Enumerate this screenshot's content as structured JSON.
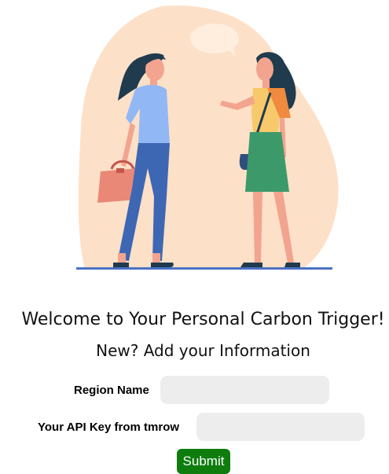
{
  "welcome_title": "Welcome to Your Personal Carbon Trigger!",
  "subtitle": "New? Add your Information",
  "form": {
    "region": {
      "label": "Region Name",
      "value": "",
      "placeholder": ""
    },
    "api_key": {
      "label": "Your API Key from tmrow",
      "value": "",
      "placeholder": ""
    },
    "submit_label": "Submit"
  },
  "colors": {
    "background": "#ffffff",
    "blob": "#fde0c8",
    "submit": "#0e7d0e",
    "input_bg": "#ededed",
    "ground_line": "#4a72c4"
  },
  "illustration": "two women talking"
}
